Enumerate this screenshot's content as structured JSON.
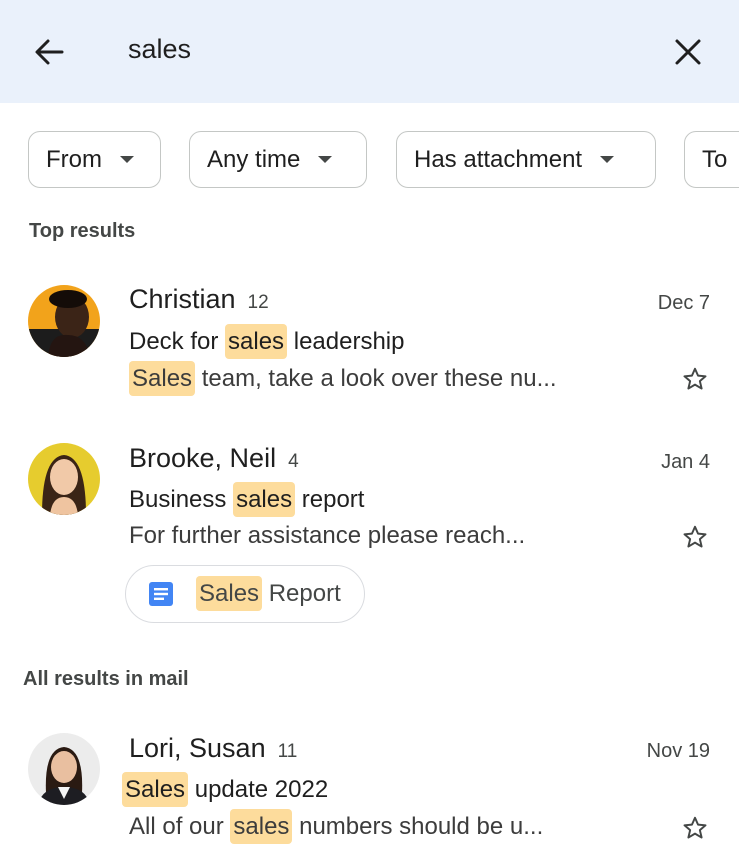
{
  "search": {
    "query": "sales",
    "back_icon": "arrow-back-icon",
    "clear_icon": "close-icon"
  },
  "filters": [
    {
      "label": "From"
    },
    {
      "label": "Any time"
    },
    {
      "label": "Has attachment"
    },
    {
      "label": "To"
    }
  ],
  "top_results": {
    "title": "Top results",
    "emails": [
      {
        "sender": "Christian",
        "count": "12",
        "date": "Dec 7",
        "subject_pre": "Deck for ",
        "subject_hl": "sales",
        "subject_post": " leadership",
        "snippet_hl": "Sales",
        "snippet_post": " team, take a look over these nu..."
      },
      {
        "sender": "Brooke, Neil",
        "count": "4",
        "date": "Jan 4",
        "subject_pre": "Business ",
        "subject_hl": "sales",
        "subject_post": " report",
        "snippet": "For further assistance please reach...",
        "attachment": {
          "hl": "Sales",
          "rest": " Report",
          "icon": "docs-icon"
        }
      }
    ]
  },
  "all_results": {
    "title": "All results in mail",
    "emails": [
      {
        "sender": "Lori, Susan",
        "count": "11",
        "date": "Nov 19",
        "subject_hl": "Sales",
        "subject_post": " update 2022",
        "snippet_pre": "All of our ",
        "snippet_hl": "sales",
        "snippet_post": " numbers should be u..."
      }
    ]
  },
  "colors": {
    "search_bg": "#eaf1fb",
    "highlight": "#fddc9c",
    "docs_blue": "#4285f4"
  }
}
